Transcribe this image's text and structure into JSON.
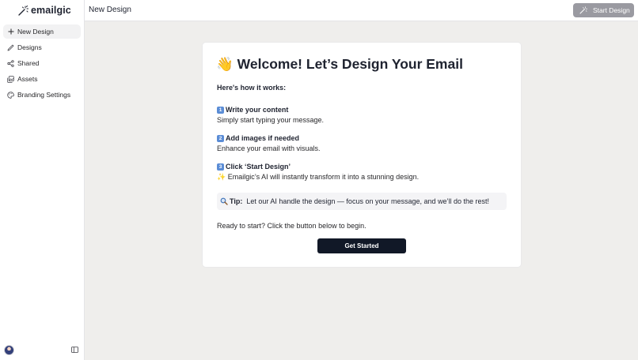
{
  "app": {
    "logo_text": "emailgic"
  },
  "sidebar": {
    "items": [
      {
        "label": "New Design",
        "icon": "plus-icon",
        "active": true
      },
      {
        "label": "Designs",
        "icon": "pen-icon",
        "active": false
      },
      {
        "label": "Shared",
        "icon": "share-icon",
        "active": false
      },
      {
        "label": "Assets",
        "icon": "image-stack-icon",
        "active": false
      },
      {
        "label": "Branding Settings",
        "icon": "palette-icon",
        "active": false
      }
    ]
  },
  "header": {
    "title": "New Design",
    "start_button_label": "Start Design"
  },
  "welcome": {
    "heading_emoji": "👋",
    "heading": "Welcome! Let’s Design Your Email",
    "how_it_works": "Here's how it works:",
    "steps": [
      {
        "num": "1",
        "title": "Write your content",
        "desc": "Simply start typing your message."
      },
      {
        "num": "2",
        "title": "Add images if needed",
        "desc": "Enhance your email with visuals."
      },
      {
        "num": "3",
        "title": "Click ‘Start Design’",
        "desc": "Emailgic’s AI will instantly transform it into a stunning design."
      }
    ],
    "tip_label": "Tip:",
    "tip_text": "Let our AI handle the design — focus on your message, and we’ll do the rest!",
    "ready_text": "Ready to start? Click the button below to begin.",
    "cta_label": "Get Started"
  },
  "colors": {
    "accent_dark": "#111827",
    "start_button_bg": "#9a9aa1",
    "background": "#efeeec"
  }
}
